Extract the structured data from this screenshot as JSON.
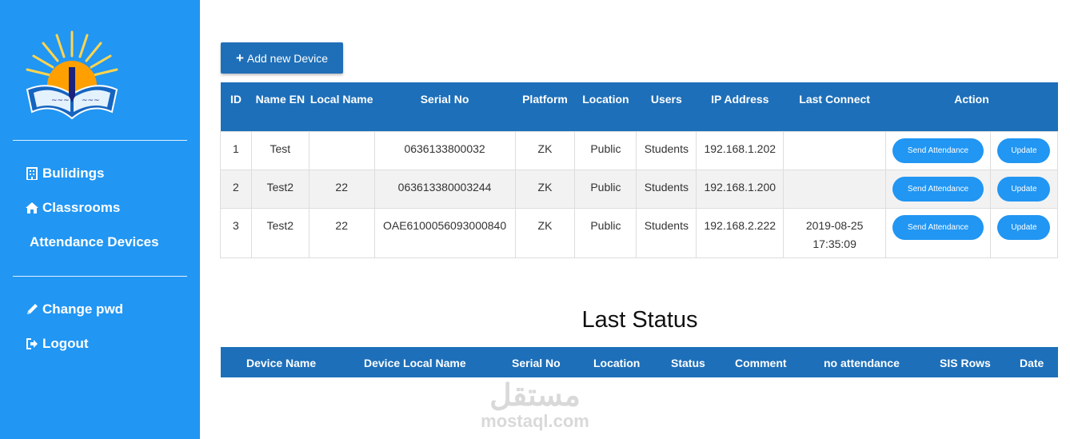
{
  "sidebar": {
    "items": [
      {
        "label": "Bulidings",
        "icon": "building-icon"
      },
      {
        "label": "Classrooms",
        "icon": "home-icon"
      },
      {
        "label": "Attendance Devices",
        "icon": ""
      },
      {
        "label": "Change pwd",
        "icon": "pencil-icon"
      },
      {
        "label": "Logout",
        "icon": "logout-icon"
      }
    ]
  },
  "add_button": {
    "label": "Add new Device",
    "icon": "plus-icon"
  },
  "devices_table": {
    "headers": [
      "ID",
      "Name EN",
      "Local Name",
      "Serial No",
      "Platform",
      "Location",
      "Users",
      "IP Address",
      "Last Connect",
      "Action"
    ],
    "rows": [
      {
        "id": "1",
        "name_en": "Test",
        "local_name": "",
        "serial": "0636133800032",
        "platform": "ZK",
        "location": "Public",
        "users": "Students",
        "ip": "192.168.1.202",
        "last_connect": "",
        "send_label": "Send Attendance",
        "update_label": "Update"
      },
      {
        "id": "2",
        "name_en": "Test2",
        "local_name": "22",
        "serial": "063613380003244",
        "platform": "ZK",
        "location": "Public",
        "users": "Students",
        "ip": "192.168.1.200",
        "last_connect": "",
        "send_label": "Send Attendance",
        "update_label": "Update"
      },
      {
        "id": "3",
        "name_en": "Test2",
        "local_name": "22",
        "serial": "OAE6100056093000840",
        "platform": "ZK",
        "location": "Public",
        "users": "Students",
        "ip": "192.168.2.222",
        "last_connect": "2019-08-25 17:35:09",
        "send_label": "Send Attendance",
        "update_label": "Update"
      }
    ]
  },
  "last_status": {
    "title": "Last Status",
    "headers": [
      "Device Name",
      "Device Local Name",
      "Serial No",
      "Location",
      "Status",
      "Comment",
      "no attendance",
      "SIS Rows",
      "Date"
    ]
  },
  "watermark": {
    "arabic": "مستقل",
    "latin": "mostaql.com"
  },
  "colors": {
    "sidebar": "#2196f3",
    "header": "#1d6fb9",
    "button": "#1f6fb8",
    "pill": "#2196f3",
    "stripe": "#f2f2f2"
  }
}
